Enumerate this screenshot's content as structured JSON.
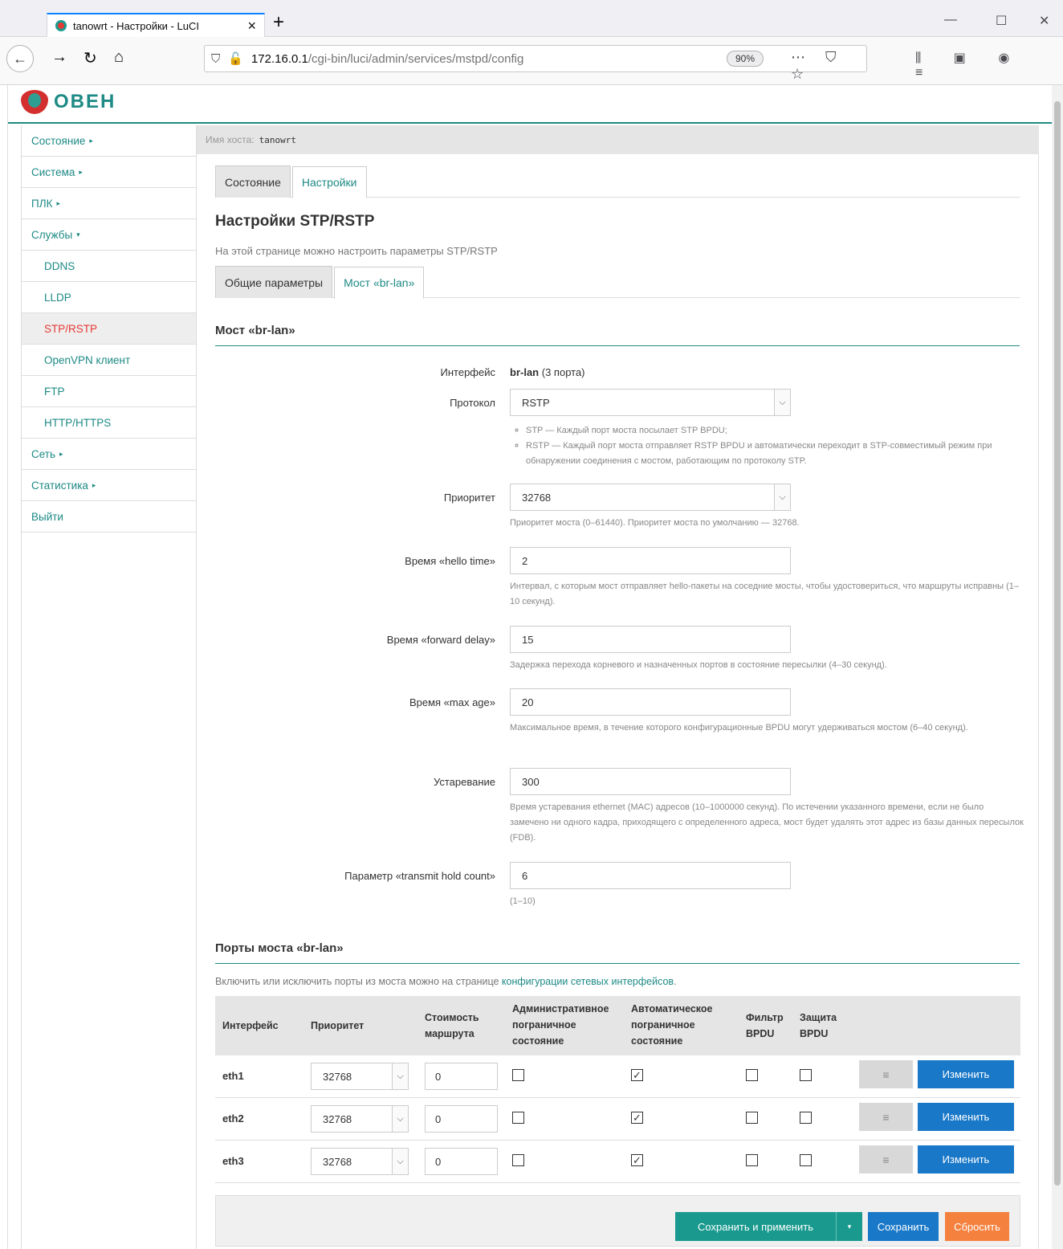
{
  "browser": {
    "tab_title": "tanowrt - Настройки - LuCI",
    "url_host": "172.16.0.1",
    "url_path": "/cgi-bin/luci/admin/services/mstpd/config",
    "zoom": "90%"
  },
  "logo": {
    "text": "ОВЕН"
  },
  "sidebar": {
    "items": [
      {
        "label": "Состояние",
        "caret": "▸"
      },
      {
        "label": "Система",
        "caret": "▸"
      },
      {
        "label": "ПЛК",
        "caret": "▸"
      },
      {
        "label": "Службы",
        "caret": "▾"
      },
      {
        "label": "DDNS"
      },
      {
        "label": "LLDP"
      },
      {
        "label": "STP/RSTP"
      },
      {
        "label": "OpenVPN клиент"
      },
      {
        "label": "FTP"
      },
      {
        "label": "HTTP/HTTPS"
      },
      {
        "label": "Сеть",
        "caret": "▸"
      },
      {
        "label": "Статистика",
        "caret": "▸"
      },
      {
        "label": "Выйти"
      }
    ]
  },
  "hostbar": {
    "label": "Имя хоста:",
    "value": "tanowrt"
  },
  "top_tabs": [
    "Состояние",
    "Настройки"
  ],
  "page": {
    "title": "Настройки STP/RSTP",
    "description": "На этой странице можно настроить параметры STP/RSTP"
  },
  "sub_tabs": [
    "Общие параметры",
    "Мост «br-lan»"
  ],
  "bridge": {
    "section_title": "Мост «br-lan»",
    "interface_label": "Интерфейс",
    "interface_name": "br-lan",
    "interface_ports": "(3 порта)",
    "protocol_label": "Протокол",
    "protocol_value": "RSTP",
    "protocol_hint_stp": "STP — Каждый порт моста посылает STP BPDU;",
    "protocol_hint_rstp": "RSTP — Каждый порт моста отправляет RSTP BPDU и автоматически переходит в STP-совместимый режим при обнаружении соединения с мостом, работающим по протоколу STP.",
    "priority_label": "Приоритет",
    "priority_value": "32768",
    "priority_hint": "Приоритет моста (0–61440). Приоритет моста по умолчанию — 32768.",
    "hello_label": "Время «hello time»",
    "hello_value": "2",
    "hello_hint": "Интервал, с которым мост отправляет hello-пакеты на соседние мосты, чтобы удостовериться, что маршруты исправны (1–10 секунд).",
    "fwd_label": "Время «forward delay»",
    "fwd_value": "15",
    "fwd_hint": "Задержка перехода корневого и назначенных портов в состояние пересылки (4–30 секунд).",
    "maxage_label": "Время «max age»",
    "maxage_value": "20",
    "maxage_hint": "Максимальное время, в течение которого конфигурационные BPDU могут удерживаться мостом (6–40 секунд).",
    "ageing_label": "Устаревание",
    "ageing_value": "300",
    "ageing_hint": "Время устаревания ethernet (MAC) адресов (10–1000000 секунд). По истечении указанного времени, если не было замечено ни одного кадра, приходящего с определенного адреса, мост будет удалять этот адрес из базы данных пересылок (FDB).",
    "txhold_label": "Параметр «transmit hold count»",
    "txhold_value": "6",
    "txhold_hint": "(1–10)"
  },
  "ports": {
    "section_title": "Порты моста «br-lan»",
    "intro_text": "Включить или исключить порты из моста можно на странице ",
    "intro_link": "конфигурации сетевых интерфейсов",
    "intro_end": ".",
    "headers": {
      "iface": "Интерфейс",
      "priority": "Приоритет",
      "cost": "Стоимость маршрута",
      "admin_edge": "Административное пограничное состояние",
      "auto_edge": "Автоматическое пограничное состояние",
      "bpdu_filter": "Фильтр BPDU",
      "bpdu_guard": "Защита BPDU"
    },
    "rows": [
      {
        "iface": "eth1",
        "priority": "32768",
        "cost": "0",
        "admin_edge": false,
        "auto_edge": true,
        "bpdu_filter": false,
        "bpdu_guard": false
      },
      {
        "iface": "eth2",
        "priority": "32768",
        "cost": "0",
        "admin_edge": false,
        "auto_edge": true,
        "bpdu_filter": false,
        "bpdu_guard": false
      },
      {
        "iface": "eth3",
        "priority": "32768",
        "cost": "0",
        "admin_edge": false,
        "auto_edge": true,
        "bpdu_filter": false,
        "bpdu_guard": false
      }
    ],
    "menu_glyph": "≡",
    "edit_label": "Изменить"
  },
  "actions": {
    "save_apply": "Сохранить и применить",
    "save": "Сохранить",
    "reset": "Сбросить"
  },
  "colors": {
    "accent": "#1d8a85",
    "primary": "#1978c8",
    "warning": "#f5813f",
    "active_nav": "#e53935"
  }
}
